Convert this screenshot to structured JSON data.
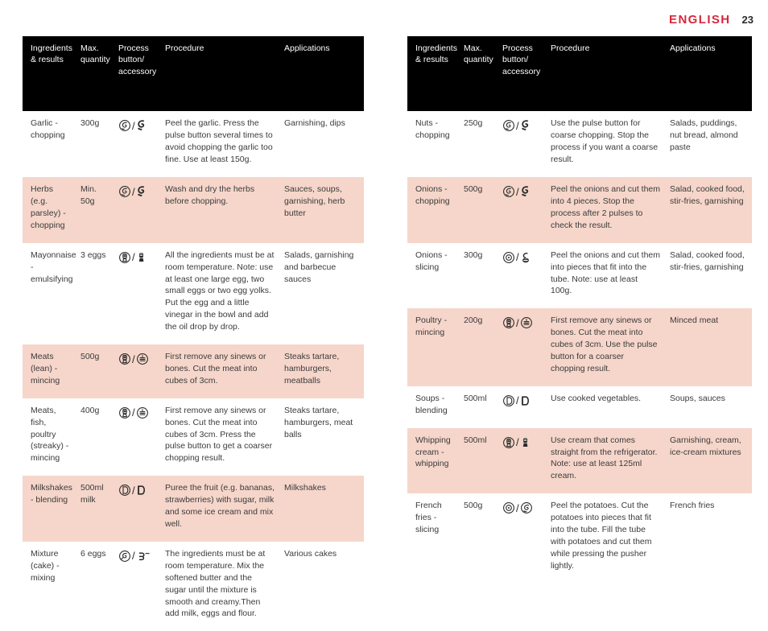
{
  "header": {
    "language": "ENGLISH",
    "page_number": "23"
  },
  "colors": {
    "accent_red": "#d6283c",
    "header_row": "#000000",
    "alt_row": "#f6d6ca",
    "text": "#3b3b3b"
  },
  "columns": [
    "Ingredients & results",
    "Max. quantity",
    "Process button/ accessory",
    "Procedure",
    "Applications"
  ],
  "left_table": {
    "rows": [
      {
        "ingredients": "Garlic - chopping",
        "quantity": "300g",
        "icons": [
          "pulse-button-icon",
          "chopping-blade-icon"
        ],
        "procedure": "Peel the garlic. Press the pulse button several times to avoid chopping the garlic too fine. Use at least 150g.",
        "applications": "Garnishing, dips",
        "shaded": false
      },
      {
        "ingredients": "Herbs (e.g. parsley) - chopping",
        "quantity": "Min. 50g",
        "icons": [
          "pulse-button-icon",
          "chopping-blade-icon"
        ],
        "procedure": "Wash and dry the herbs before chopping.",
        "applications": "Sauces, soups, garnishing, herb butter",
        "shaded": true
      },
      {
        "ingredients": "Mayonnaise - emulsifying",
        "quantity": "3 eggs",
        "icons": [
          "speed-button-icon",
          "emulsifying-disc-icon"
        ],
        "procedure": "All the ingredients must be at room temperature. Note: use at least one large egg, two small eggs or two egg yolks. Put the egg and a little vinegar in the bowl and add the oil drop by drop.",
        "applications": "Salads, garnishing and barbecue sauces",
        "shaded": false
      },
      {
        "ingredients": "Meats (lean) - mincing",
        "quantity": "500g",
        "icons": [
          "speed-button-icon",
          "mincing-blade-icon"
        ],
        "procedure": "First remove any sinews or bones. Cut the meat into cubes of 3cm.",
        "applications": "Steaks tartare, hamburgers, meatballs",
        "shaded": true
      },
      {
        "ingredients": "Meats, fish, poultry (streaky) - mincing",
        "quantity": "400g",
        "icons": [
          "speed-button-icon",
          "mincing-blade-icon"
        ],
        "procedure": "First remove any sinews or bones. Cut the meat into cubes of 3cm. Press the pulse button to get a coarser chopping result.",
        "applications": "Steaks tartare, hamburgers, meat balls",
        "shaded": false
      },
      {
        "ingredients": "Milkshakes - blending",
        "quantity": "500ml milk",
        "icons": [
          "blender-button-icon",
          "blender-jar-icon"
        ],
        "procedure": "Puree the fruit (e.g. bananas, strawberries) with sugar, milk and some ice cream and mix well.",
        "applications": "Milkshakes",
        "shaded": true
      },
      {
        "ingredients": "Mixture (cake) - mixing",
        "quantity": "6 eggs",
        "icons": [
          "mixing-button-icon",
          "mixing-tool-icon"
        ],
        "procedure": "The ingredients must be at room temperature. Mix the softened butter and the sugar until the mixture is smooth and creamy.Then add milk, eggs and flour.",
        "applications": "Various cakes",
        "shaded": false
      }
    ]
  },
  "right_table": {
    "rows": [
      {
        "ingredients": "Nuts - chopping",
        "quantity": "250g",
        "icons": [
          "pulse-button-icon",
          "chopping-blade-icon"
        ],
        "procedure": "Use the pulse button for coarse chopping. Stop the process if you want a coarse result.",
        "applications": "Salads, puddings, nut bread, almond paste",
        "shaded": false
      },
      {
        "ingredients": "Onions - chopping",
        "quantity": "500g",
        "icons": [
          "pulse-button-icon",
          "chopping-blade-icon"
        ],
        "procedure": "Peel the onions and cut them into 4 pieces. Stop the process after 2 pulses to check the result.",
        "applications": "Salad, cooked food, stir-fries, garnishing",
        "shaded": true
      },
      {
        "ingredients": "Onions - slicing",
        "quantity": "300g",
        "icons": [
          "speed-dial-icon",
          "slicing-disc-icon"
        ],
        "procedure": "Peel the onions and cut them into pieces that fit into the tube. Note: use at least 100g.",
        "applications": "Salad, cooked food, stir-fries, garnishing",
        "shaded": false
      },
      {
        "ingredients": "Poultry - mincing",
        "quantity": "200g",
        "icons": [
          "speed-button-icon",
          "mincing-blade-icon"
        ],
        "procedure": "First remove any sinews or bones. Cut the meat into cubes of 3cm. Use the pulse button for a coarser chopping result.",
        "applications": "Minced meat",
        "shaded": true
      },
      {
        "ingredients": "Soups - blending",
        "quantity": "500ml",
        "icons": [
          "blender-button-icon",
          "blender-jar-icon"
        ],
        "procedure": "Use cooked vegetables.",
        "applications": "Soups, sauces",
        "shaded": false
      },
      {
        "ingredients": "Whipping cream - whipping",
        "quantity": "500ml",
        "icons": [
          "speed-button-icon",
          "emulsifying-disc-icon"
        ],
        "procedure": "Use cream that comes straight from the refrigerator. Note: use at least 125ml cream.",
        "applications": "Garnishing, cream, ice-cream mixtures",
        "shaded": true
      },
      {
        "ingredients": "French fries - slicing",
        "quantity": "500g",
        "icons": [
          "speed-dial-icon",
          "french-fries-disc-icon"
        ],
        "procedure": "Peel the potatoes. Cut the potatoes into pieces that fit into the tube. Fill the tube with potatoes and cut them while pressing the pusher lightly.",
        "applications": "French fries",
        "shaded": false
      }
    ]
  }
}
